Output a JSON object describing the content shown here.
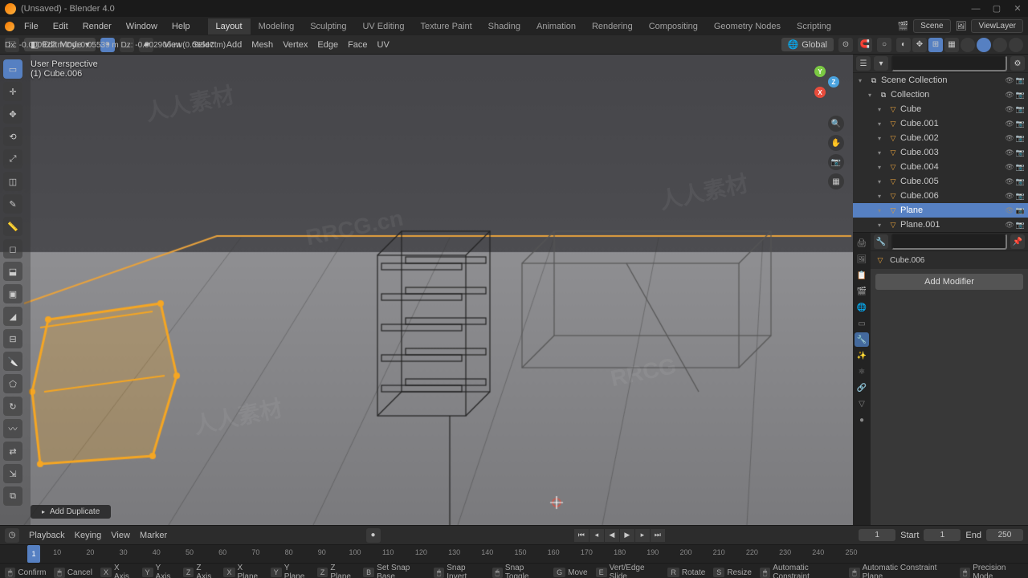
{
  "title": "(Unsaved) - Blender 4.0",
  "menus": [
    "File",
    "Edit",
    "Render",
    "Window",
    "Help"
  ],
  "workspaces": [
    "Layout",
    "Modeling",
    "Sculpting",
    "UV Editing",
    "Texture Paint",
    "Shading",
    "Animation",
    "Rendering",
    "Compositing",
    "Geometry Nodes",
    "Scripting"
  ],
  "active_workspace": "Layout",
  "scene_label": "Scene",
  "viewlayer_label": "ViewLayer",
  "mode": "Edit Mode",
  "view_menus": [
    "View",
    "Select",
    "Add",
    "Mesh",
    "Vertex",
    "Edge",
    "Face",
    "UV"
  ],
  "orientation": "Global",
  "readout": "Dx: -0.000922 m     Dy: 0.05539 m     Dz: -0.002906 m (0.05547 m)",
  "overlay": {
    "persp": "User Perspective",
    "obj": "(1) Cube.006"
  },
  "add_dup": "Add Duplicate",
  "outliner": {
    "root": "Scene Collection",
    "collection": "Collection",
    "items": [
      {
        "name": "Cube",
        "type": "mesh"
      },
      {
        "name": "Cube.001",
        "type": "mesh"
      },
      {
        "name": "Cube.002",
        "type": "mesh"
      },
      {
        "name": "Cube.003",
        "type": "mesh"
      },
      {
        "name": "Cube.004",
        "type": "mesh"
      },
      {
        "name": "Cube.005",
        "type": "mesh"
      },
      {
        "name": "Cube.006",
        "type": "mesh"
      },
      {
        "name": "Plane",
        "type": "mesh",
        "selected": true
      },
      {
        "name": "Plane.001",
        "type": "mesh"
      }
    ]
  },
  "properties": {
    "object": "Cube.006",
    "add_mod": "Add Modifier"
  },
  "timeline": {
    "dropdowns": [
      "Playback",
      "Keying",
      "View",
      "Marker"
    ],
    "current": 1,
    "start_lbl": "Start",
    "start": 1,
    "end_lbl": "End",
    "end": 250,
    "ticks": [
      10,
      20,
      30,
      40,
      50,
      60,
      70,
      80,
      90,
      100,
      110,
      120,
      130,
      140,
      150,
      160,
      170,
      180,
      190,
      200,
      210,
      220,
      230,
      240,
      250
    ]
  },
  "statusbar": [
    {
      "k": "",
      "t": "Confirm"
    },
    {
      "k": "",
      "t": "Cancel"
    },
    {
      "k": "X",
      "t": "X Axis"
    },
    {
      "k": "Y",
      "t": "Y Axis"
    },
    {
      "k": "Z",
      "t": "Z Axis"
    },
    {
      "k": "X",
      "t": "X Plane"
    },
    {
      "k": "Y",
      "t": "Y Plane"
    },
    {
      "k": "Z",
      "t": "Z Plane"
    },
    {
      "k": "B",
      "t": "Set Snap Base"
    },
    {
      "k": "",
      "t": "Snap Invert"
    },
    {
      "k": "",
      "t": "Snap Toggle"
    },
    {
      "k": "G",
      "t": "Move"
    },
    {
      "k": "E",
      "t": "Vert/Edge Slide"
    },
    {
      "k": "R",
      "t": "Rotate"
    },
    {
      "k": "S",
      "t": "Resize"
    },
    {
      "k": "",
      "t": "Automatic Constraint"
    },
    {
      "k": "",
      "t": "Automatic Constraint Plane"
    },
    {
      "k": "",
      "t": "Precision Mode"
    }
  ],
  "watermarks": [
    "RRCG.cn",
    "人人素材",
    "RRCG",
    "人人素材"
  ],
  "chart_data": null
}
